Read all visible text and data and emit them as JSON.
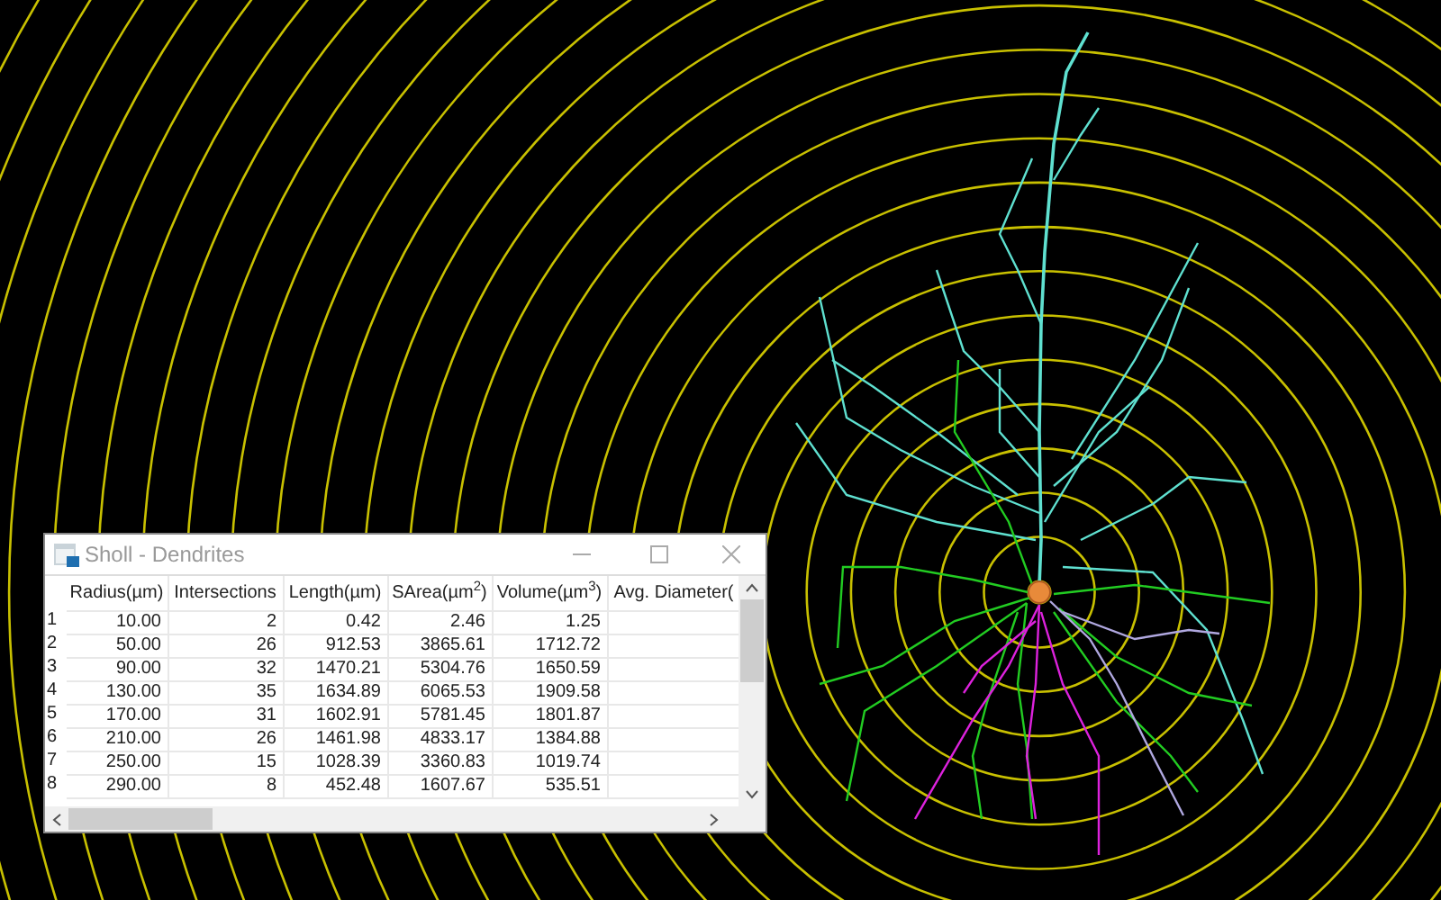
{
  "window": {
    "title": "Sholl - Dendrites"
  },
  "table": {
    "columns": [
      "Radius(µm)",
      "Intersections",
      "Length(µm)",
      "SArea(µm$^{2}$)",
      "Volume(µm$^{3}$)",
      "Avg. Diameter("
    ],
    "rows": [
      {
        "index": "1",
        "cells": [
          "10.00",
          "2",
          "0.42",
          "2.46",
          "1.25"
        ]
      },
      {
        "index": "2",
        "cells": [
          "50.00",
          "26",
          "912.53",
          "3865.61",
          "1712.72"
        ]
      },
      {
        "index": "3",
        "cells": [
          "90.00",
          "32",
          "1470.21",
          "5304.76",
          "1650.59"
        ]
      },
      {
        "index": "4",
        "cells": [
          "130.00",
          "35",
          "1634.89",
          "6065.53",
          "1909.58"
        ]
      },
      {
        "index": "5",
        "cells": [
          "170.00",
          "31",
          "1602.91",
          "5781.45",
          "1801.87"
        ]
      },
      {
        "index": "6",
        "cells": [
          "210.00",
          "26",
          "1461.98",
          "4833.17",
          "1384.88"
        ]
      },
      {
        "index": "7",
        "cells": [
          "250.00",
          "15",
          "1028.39",
          "3360.83",
          "1019.74"
        ]
      },
      {
        "index": "8",
        "cells": [
          "290.00",
          "8",
          "452.48",
          "1607.67",
          "535.51"
        ]
      }
    ]
  }
}
